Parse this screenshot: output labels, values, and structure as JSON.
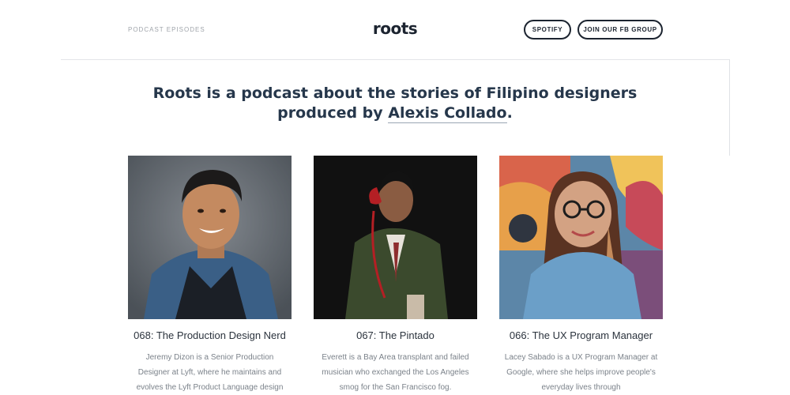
{
  "header": {
    "nav_left": "PODCAST EPISODES",
    "logo": "roots",
    "buttons": {
      "spotify": "SPOTIFY",
      "fb_group": "JOIN OUR FB GROUP"
    }
  },
  "intro": {
    "line1": "Roots is a podcast about the stories of Filipino designers",
    "line2_prefix": "produced by ",
    "author": "Alexis Collado",
    "line2_suffix": "."
  },
  "episodes": [
    {
      "title": "068: The Production Design Nerd",
      "description": "Jeremy Dizon is a Senior Production Designer at Lyft, where he maintains and evolves the Lyft Product Language design"
    },
    {
      "title": "067: The Pintado",
      "description": "Everett is a Bay Area transplant and failed musician who exchanged the Los Angeles smog for the San Francisco fog."
    },
    {
      "title": "066: The UX Program Manager",
      "description": "Lacey Sabado is a UX Program Manager at Google, where she helps improve people's everyday lives through"
    }
  ],
  "icons": {
    "photo1": "portrait-photo",
    "photo2": "portrait-photo",
    "photo3": "portrait-photo"
  }
}
